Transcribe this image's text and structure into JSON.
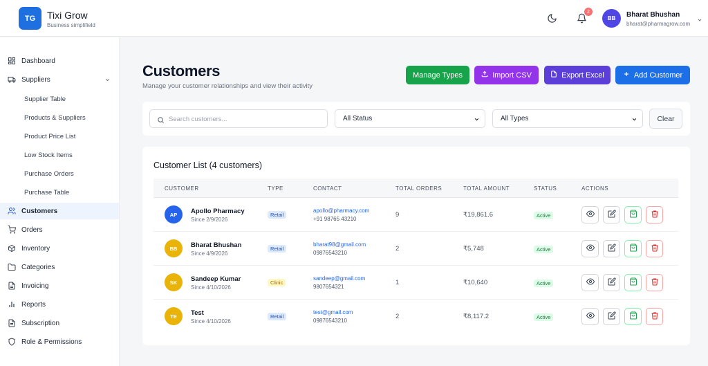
{
  "brand": {
    "logo_initials": "TG",
    "name": "Tixi Grow",
    "tagline": "Business simplifield"
  },
  "header": {
    "notification_count": "2",
    "user": {
      "initials": "BB",
      "name": "Bharat Bhushan",
      "email": "bharat@pharmagrow.com"
    },
    "icons": [
      "moon-icon",
      "bell-icon",
      "chevron-down-icon"
    ]
  },
  "sidebar": {
    "items": [
      {
        "label": "Dashboard",
        "icon": "dashboard-icon"
      },
      {
        "label": "Suppliers",
        "icon": "truck-icon"
      },
      {
        "label": "Customers",
        "icon": "users-icon"
      },
      {
        "label": "Orders",
        "icon": "cart-icon"
      },
      {
        "label": "Inventory",
        "icon": "box-icon"
      },
      {
        "label": "Categories",
        "icon": "folder-icon"
      },
      {
        "label": "Invoicing",
        "icon": "file-icon"
      },
      {
        "label": "Reports",
        "icon": "bar-chart-icon"
      },
      {
        "label": "Subscription",
        "icon": "file-icon"
      },
      {
        "label": "Role & Permissions",
        "icon": "shield-icon"
      }
    ],
    "supplier_subitems": [
      "Supplier Table",
      "Products & Suppliers",
      "Product Price List",
      "Low Stock Items",
      "Purchase Orders",
      "Purchase Table"
    ],
    "active": "Customers"
  },
  "page": {
    "title": "Customers",
    "subtitle": "Manage your customer relationships and view their activity",
    "buttons": {
      "manage_types": "Manage Types",
      "import_csv": "Import CSV",
      "export_excel": "Export Excel",
      "add_customer": "Add Customer"
    }
  },
  "filters": {
    "search_placeholder": "Search customers...",
    "status_value": "All Status",
    "types_value": "All Types",
    "clear_label": "Clear"
  },
  "table": {
    "title": "Customer List (4 customers)",
    "headers": [
      "CUSTOMER",
      "TYPE",
      "CONTACT",
      "TOTAL ORDERS",
      "TOTAL AMOUNT",
      "STATUS",
      "ACTIONS"
    ],
    "rows": [
      {
        "initials": "AP",
        "name": "Apollo Pharmacy",
        "since": "Since 2/9/2026",
        "type": "Retail",
        "email": "apollo@pharmacy.com",
        "phone": "+91 98765 43210",
        "orders": "9",
        "amount": "₹19,861.6",
        "status": "Active",
        "avatar_color": "#2563eb"
      },
      {
        "initials": "BB",
        "name": "Bharat Bhushan",
        "since": "Since 4/9/2026",
        "type": "Retail",
        "email": "bharat98@gmail.com",
        "phone": "09876543210",
        "orders": "2",
        "amount": "₹5,748",
        "status": "Active",
        "avatar_color": "#eab308"
      },
      {
        "initials": "SK",
        "name": "Sandeep Kumar",
        "since": "Since 4/10/2026",
        "type": "Clinic",
        "email": "sandeep@gmail.com",
        "phone": "9807654321",
        "orders": "1",
        "amount": "₹10,640",
        "status": "Active",
        "avatar_color": "#eab308"
      },
      {
        "initials": "TE",
        "name": "Test",
        "since": "Since 4/10/2026",
        "type": "Retail",
        "email": "test@gmail.com",
        "phone": "09876543210",
        "orders": "2",
        "amount": "₹8,117.2",
        "status": "Active",
        "avatar_color": "#eab308"
      }
    ]
  },
  "colors": {
    "primary": "#1d6fe8",
    "manage_types": "#16a34a",
    "import_csv": "#9333ea",
    "export_excel": "#5b3fd8",
    "retail_badge": "#dbeafe",
    "clinic_badge": "#fef9c3",
    "active_badge": "#dcfce7"
  }
}
